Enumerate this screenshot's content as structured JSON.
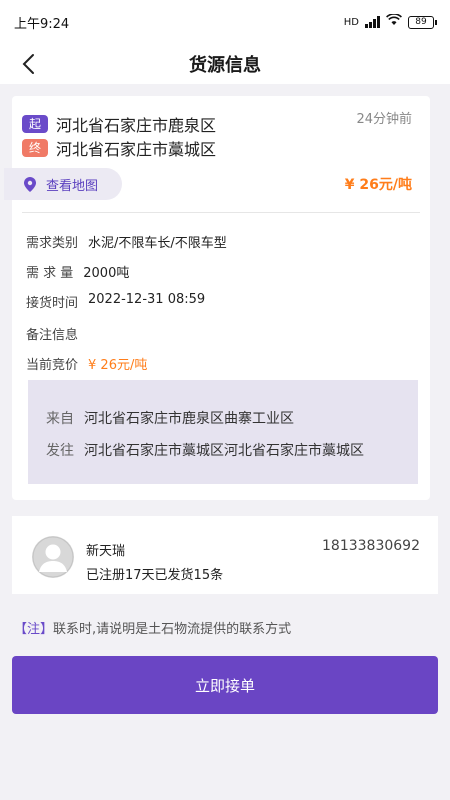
{
  "status_bar": {
    "time": "上午9:24",
    "network": "HD",
    "battery": "89"
  },
  "nav": {
    "title": "货源信息"
  },
  "cargo": {
    "start_tag": "起",
    "end_tag": "终",
    "origin": "河北省石家庄市鹿泉区",
    "destination": "河北省石家庄市藁城区",
    "time_ago": "24分钟前",
    "map_label": "查看地图",
    "price": "¥ 26元/吨"
  },
  "details": {
    "category_label": "需求类别",
    "category_value": "水泥/不限车长/不限车型",
    "quantity_label": "需 求 量",
    "quantity_value": "2000吨",
    "pickup_label": "接货时间",
    "pickup_value": "2022-12-31 08:59",
    "remark_label": "备注信息",
    "bid_label": "当前竞价",
    "bid_value": "¥ 26元/吨"
  },
  "address": {
    "from_label": "来自",
    "from_value": "河北省石家庄市鹿泉区曲寨工业区",
    "to_label": "发往",
    "to_value": "河北省石家庄市藁城区河北省石家庄市藁城区"
  },
  "shipper": {
    "name": "新天瑞",
    "meta": "已注册17天已发货15条",
    "phone": "18133830692"
  },
  "notice": {
    "tag": "【注】",
    "text": "联系时,请说明是土石物流提供的联系方式"
  },
  "action": {
    "accept_label": "立即接单"
  },
  "colors": {
    "accent": "#6a45c4",
    "price": "#ff7d1a",
    "end_tag": "#f07a66"
  }
}
